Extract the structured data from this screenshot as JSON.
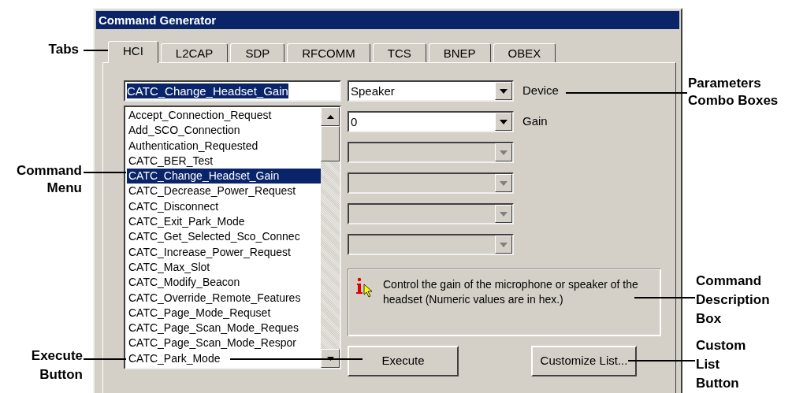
{
  "window": {
    "title": "Command Generator"
  },
  "tabs": [
    {
      "label": "HCI",
      "selected": true
    },
    {
      "label": "L2CAP",
      "selected": false
    },
    {
      "label": "SDP",
      "selected": false
    },
    {
      "label": "RFCOMM",
      "selected": false
    },
    {
      "label": "TCS",
      "selected": false
    },
    {
      "label": "BNEP",
      "selected": false
    },
    {
      "label": "OBEX",
      "selected": false
    }
  ],
  "command_field": {
    "value": "CATC_Change_Headset_Gain"
  },
  "command_list": [
    {
      "label": "Accept_Connection_Request",
      "selected": false
    },
    {
      "label": "Add_SCO_Connection",
      "selected": false
    },
    {
      "label": "Authentication_Requested",
      "selected": false
    },
    {
      "label": "CATC_BER_Test",
      "selected": false
    },
    {
      "label": "CATC_Change_Headset_Gain",
      "selected": true
    },
    {
      "label": "CATC_Decrease_Power_Request",
      "selected": false
    },
    {
      "label": "CATC_Disconnect",
      "selected": false
    },
    {
      "label": "CATC_Exit_Park_Mode",
      "selected": false
    },
    {
      "label": "CATC_Get_Selected_Sco_Connec",
      "selected": false
    },
    {
      "label": "CATC_Increase_Power_Request",
      "selected": false
    },
    {
      "label": "CATC_Max_Slot",
      "selected": false
    },
    {
      "label": "CATC_Modify_Beacon",
      "selected": false
    },
    {
      "label": "CATC_Override_Remote_Features",
      "selected": false
    },
    {
      "label": "CATC_Page_Mode_Requset",
      "selected": false
    },
    {
      "label": "CATC_Page_Scan_Mode_Reques",
      "selected": false
    },
    {
      "label": "CATC_Page_Scan_Mode_Respor",
      "selected": false
    },
    {
      "label": "CATC_Park_Mode",
      "selected": false
    }
  ],
  "parameters": [
    {
      "value": "Speaker",
      "label": "Device",
      "disabled": false
    },
    {
      "value": "0",
      "label": "Gain",
      "disabled": false
    },
    {
      "disabled": true
    },
    {
      "disabled": true
    },
    {
      "disabled": true
    },
    {
      "disabled": true
    }
  ],
  "description": "Control the gain of the microphone or speaker of the headset (Numeric values are in hex.)",
  "buttons": [
    "Execute",
    "Customize List..."
  ],
  "annotations": [
    {
      "lines": [
        "Tabs"
      ]
    },
    {
      "lines": [
        "Command",
        "Menu"
      ]
    },
    {
      "lines": [
        "Execute",
        "Button"
      ]
    },
    {
      "lines": [
        "Parameters",
        "Combo Boxes"
      ]
    },
    {
      "lines": [
        "Command",
        "Description",
        "Box"
      ]
    },
    {
      "lines": [
        "Custom",
        "List",
        "Button"
      ]
    }
  ]
}
